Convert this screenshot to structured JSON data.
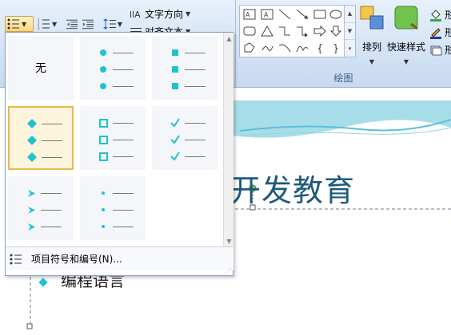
{
  "ribbon": {
    "paragraph": {
      "text_direction_label": "文字方向",
      "align_text_label": "对齐文本"
    },
    "drawing": {
      "arrange_label": "排列",
      "quick_styles_label": "快速样式",
      "shape_fill_label": "形",
      "shape_outline_label": "形",
      "shape_effects_label": "形",
      "group_label": "绘图"
    }
  },
  "bullets_dropdown": {
    "none_label": "无",
    "styles": [
      {
        "name": "none",
        "selected": false
      },
      {
        "name": "filled-round",
        "selected": false
      },
      {
        "name": "filled-square",
        "selected": false
      },
      {
        "name": "filled-diamond",
        "selected": true
      },
      {
        "name": "hollow-square",
        "selected": false
      },
      {
        "name": "checkmark",
        "selected": false
      },
      {
        "name": "arrowhead",
        "selected": false
      },
      {
        "name": "small-dot",
        "selected": false
      }
    ],
    "footer_label": "项目符号和编号(N)..."
  },
  "slide": {
    "title_fragment": "开发教育",
    "bullet_fragment": "编程语言"
  },
  "colors": {
    "bullet": "#1cc3d0",
    "selection_border": "#e8b94b",
    "title": "#1e5a7a"
  }
}
